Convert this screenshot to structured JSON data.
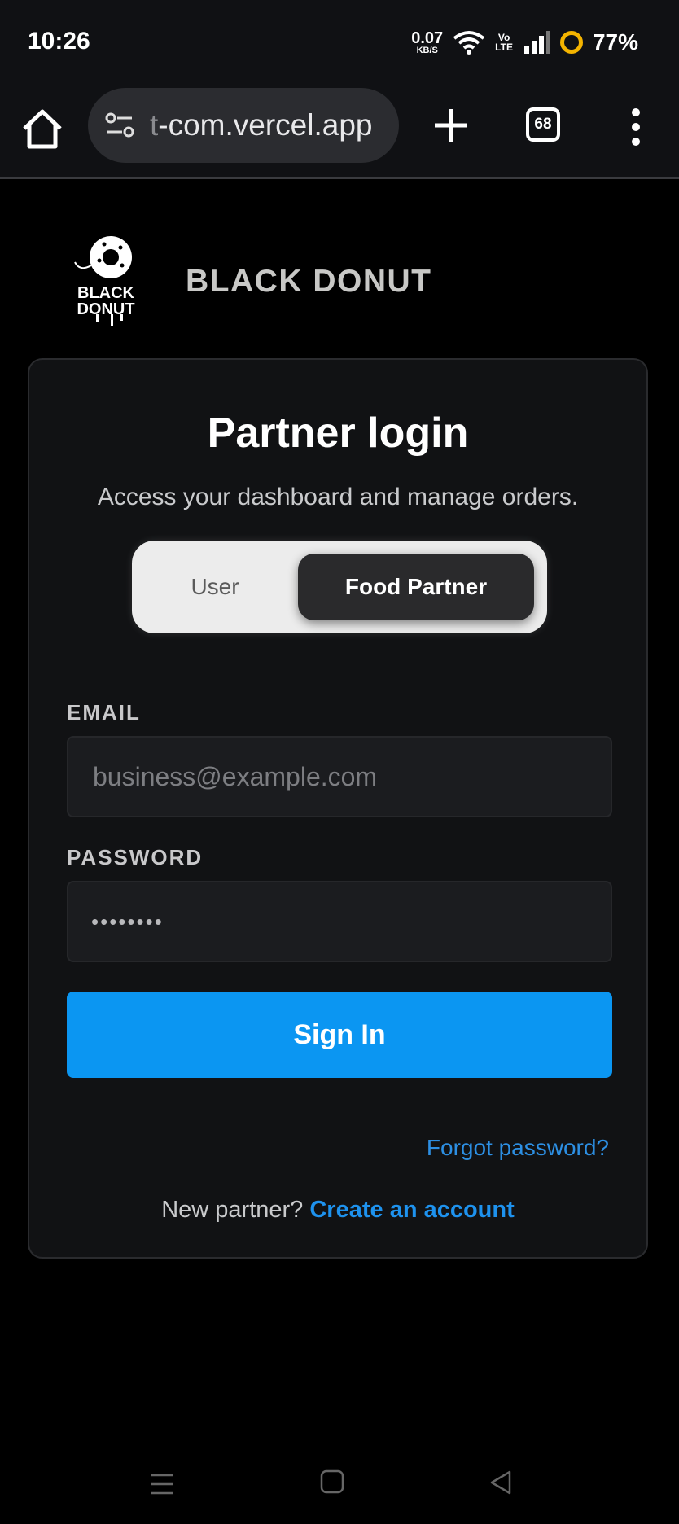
{
  "status_bar": {
    "time": "10:26",
    "net_speed_value": "0.07",
    "net_speed_unit": "KB/S",
    "volte_top": "Vo",
    "volte_bottom": "LTE",
    "battery": "77%",
    "battery_ring_color": "#f4b400"
  },
  "browser": {
    "url_prefix": "t",
    "url_main": "-com.vercel.app",
    "tab_count": "68"
  },
  "brand": {
    "logo_line1": "BLACK",
    "logo_line2": "DONUT",
    "name": "BLACK DONUT"
  },
  "card": {
    "title": "Partner login",
    "subtitle": "Access your dashboard and manage orders.",
    "roles": {
      "user_label": "User",
      "partner_label": "Food Partner",
      "selected": "Food Partner"
    },
    "email": {
      "label": "EMAIL",
      "placeholder": "business@example.com",
      "value": ""
    },
    "password": {
      "label": "PASSWORD",
      "masked_value": "••••••••"
    },
    "sign_in_label": "Sign In",
    "forgot_label": "Forgot password?",
    "new_partner_text": "New partner?",
    "create_account_label": "Create an account"
  },
  "colors": {
    "accent": "#0b96f2",
    "link": "#1e92ee"
  },
  "icons": {
    "home": "home-icon",
    "site_settings": "site-settings-icon",
    "new_tab": "plus-icon",
    "tabs": "tab-switcher-icon",
    "menu": "kebab-menu-icon",
    "nav_recent": "recent-apps-icon",
    "nav_home": "home-square-icon",
    "nav_back": "back-triangle-icon"
  }
}
